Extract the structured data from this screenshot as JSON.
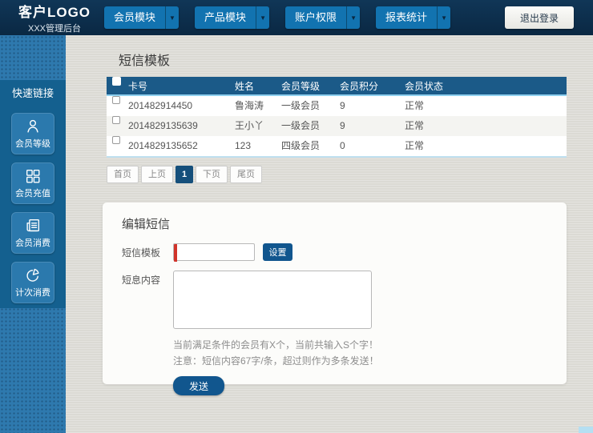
{
  "header": {
    "logo_title": "客户LOGO",
    "logo_subtitle": "XXX管理后台",
    "nav": [
      {
        "label": "会员模块"
      },
      {
        "label": "产品模块"
      },
      {
        "label": "账户权限"
      },
      {
        "label": "报表统计"
      }
    ],
    "logout_label": "退出登录"
  },
  "sidebar": {
    "quick_links_label": "快速链接",
    "items": [
      {
        "label": "会员等级",
        "icon": "user-icon"
      },
      {
        "label": "会员充值",
        "icon": "grid-icon"
      },
      {
        "label": "会员消费",
        "icon": "receipt-icon"
      },
      {
        "label": "计次消费",
        "icon": "pie-chart-icon"
      }
    ]
  },
  "table_section": {
    "title": "短信模板",
    "columns": [
      "卡号",
      "姓名",
      "会员等级",
      "会员积分",
      "会员状态"
    ],
    "rows": [
      {
        "card_no": "201482914450",
        "name": "鲁海涛",
        "level": "一级会员",
        "points": "9",
        "status": "正常"
      },
      {
        "card_no": "2014829135639",
        "name": "王小丫",
        "level": "一级会员",
        "points": "9",
        "status": "正常"
      },
      {
        "card_no": "2014829135652",
        "name": "123",
        "level": "四级会员",
        "points": "0",
        "status": "正常"
      }
    ],
    "pagination": {
      "first": "首页",
      "prev": "上页",
      "current": "1",
      "next": "下页",
      "last": "尾页"
    }
  },
  "edit_section": {
    "title": "编辑短信",
    "template_label": "短信模板",
    "template_value": "",
    "set_button_label": "设置",
    "content_label": "短息内容",
    "content_value": "",
    "note_count": "当前满足条件的会员有X个，当前共输入S个字！",
    "note_warning": "注意：短信内容67字/条，超过则作为多条发送！",
    "send_button_label": "发送"
  },
  "colors": {
    "header_bg": "#0c2e4c",
    "nav_button_blue": "#1273b0",
    "sidebar_dotted_blue": "#2e79ae",
    "sidebar_panel_blue": "#14608f",
    "table_header_blue": "#1b5a88",
    "accent_light_blue": "#8fd0ef",
    "primary_button_blue": "#11568e",
    "active_page_blue": "#154f7b",
    "required_marker_red": "#d1342b"
  }
}
